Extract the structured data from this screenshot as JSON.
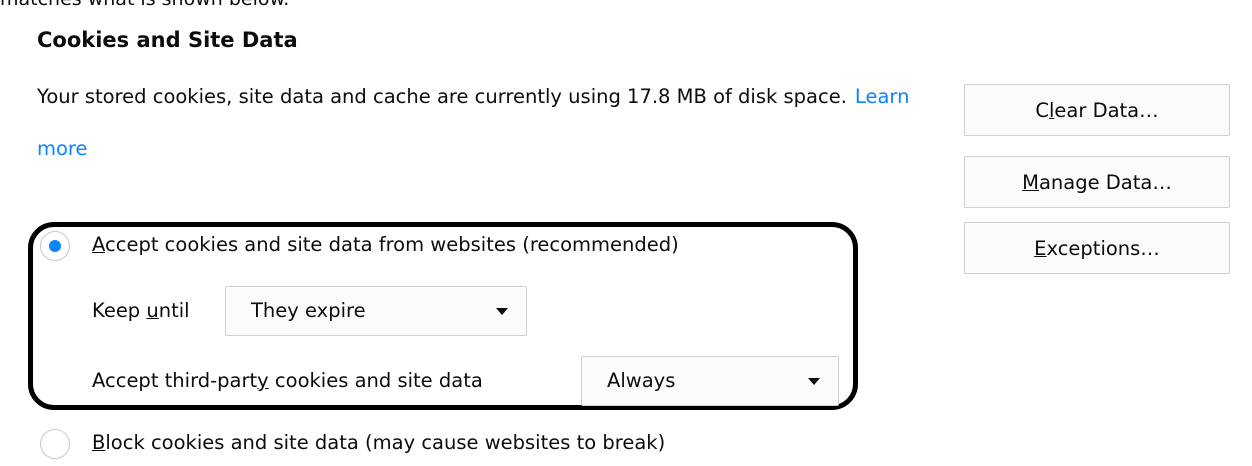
{
  "top_cut_text": "matches what is shown below.",
  "section": {
    "title": "Cookies and Site Data",
    "description": "Your stored cookies, site data and cache are currently using 17.8 MB of disk space.",
    "learn_more": "Learn more"
  },
  "buttons": {
    "clear_data": {
      "pre": "C",
      "key": "l",
      "post": "ear Data…"
    },
    "manage_data": {
      "pre": "",
      "key": "M",
      "post": "anage Data…"
    },
    "exceptions": {
      "pre": "",
      "key": "E",
      "post": "xceptions…"
    }
  },
  "accept_option": {
    "key": "A",
    "label_rest": "ccept cookies and site data from websites (recommended)",
    "checked": true
  },
  "keep_until": {
    "label_pre": "Keep ",
    "label_key": "u",
    "label_post": "ntil",
    "selected": "They expire"
  },
  "third_party": {
    "label_pre": "Accept third-part",
    "label_key": "y",
    "label_post": " cookies and site data",
    "selected": "Always"
  },
  "block_option": {
    "key": "B",
    "label_rest": "lock cookies and site data (may cause websites to break)",
    "checked": false
  },
  "colors": {
    "accent": "#0a84ff",
    "highlight_border": "#000000",
    "button_border": "#cfcfd3"
  }
}
